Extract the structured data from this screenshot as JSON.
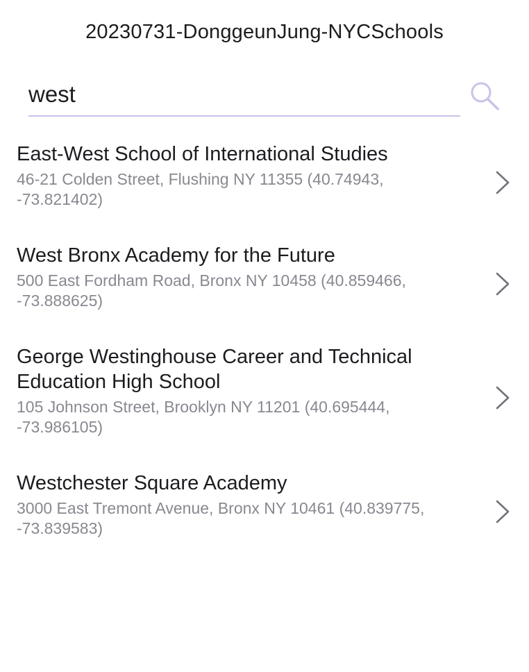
{
  "app_bar": {
    "title": "20230731-DonggeunJung-NYCSchools"
  },
  "search": {
    "value": "west",
    "icon": "search-icon"
  },
  "schools": [
    {
      "name": "East-West School of International Studies",
      "address": "46-21 Colden Street, Flushing NY 11355 (40.74943, -73.821402)"
    },
    {
      "name": "West Bronx Academy for the Future",
      "address": "500 East Fordham Road, Bronx NY 10458 (40.859466, -73.888625)"
    },
    {
      "name": "George Westinghouse Career and Technical Education High School",
      "address": "105 Johnson Street, Brooklyn NY 11201 (40.695444, -73.986105)"
    },
    {
      "name": "Westchester Square Academy",
      "address": "3000 East Tremont Avenue, Bronx NY 10461 (40.839775, -73.839583)"
    }
  ],
  "colors": {
    "accent": "#c9c2ea",
    "text_primary": "#1c1b1f",
    "text_secondary": "#8a8790",
    "chevron": "#74717a"
  }
}
